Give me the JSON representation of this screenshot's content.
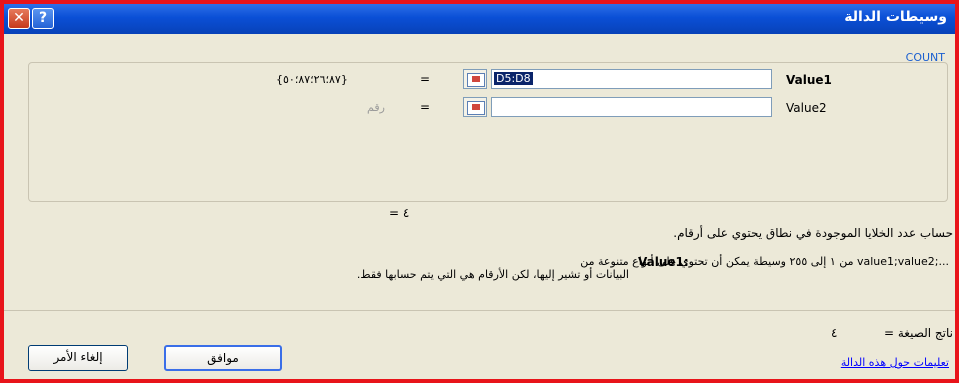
{
  "window": {
    "title": "وسيطات الدالة",
    "close_glyph": "✕",
    "help_glyph": "?"
  },
  "function_name": "COUNT",
  "args": [
    {
      "label": "Value1",
      "input_value": "D5:D8",
      "preview": "{٨٧؛٢٦؛٨٧؛٥٠}"
    },
    {
      "label": "Value2",
      "input_value": "",
      "preview": "رقم"
    }
  ],
  "equals": "=",
  "result_line": "٤ =",
  "description": "حساب عدد الخلايا الموجودة في نطاق يحتوي على أرقام.",
  "arg_help": {
    "name": "Value1:",
    "text_line1": "...;value1;value2 من ١ إلى ٢٥٥ وسيطة يمكن أن تحتوي على أنواع متنوعة من",
    "text_line2": "البيانات أو تشير إليها، لكن الأرقام هي التي يتم حسابها فقط."
  },
  "formula_result": {
    "label": "ناتج الصيغة =",
    "value": "٤"
  },
  "help_link": "تعليمات حول هذه الدالة",
  "buttons": {
    "ok": "موافق",
    "cancel": "إلغاء الأمر"
  }
}
